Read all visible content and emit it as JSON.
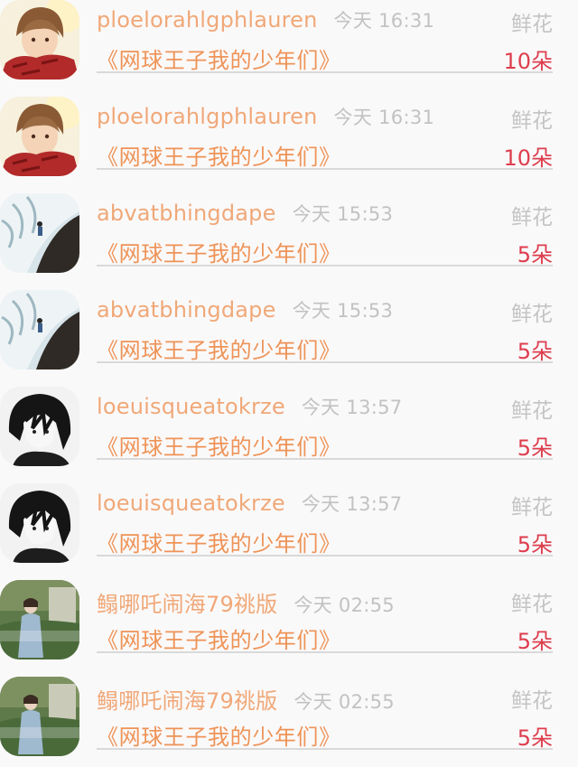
{
  "records": [
    {
      "avatar_icon": "boy-red-scarf-avatar",
      "username": "ploelorahlgphlauren",
      "time": "今天 16:31",
      "gift": "鲜花",
      "title": "《网球王子我的少年们》",
      "count": "10朵"
    },
    {
      "avatar_icon": "boy-red-scarf-avatar",
      "username": "ploelorahlgphlauren",
      "time": "今天 16:31",
      "gift": "鲜花",
      "title": "《网球王子我的少年们》",
      "count": "10朵"
    },
    {
      "avatar_icon": "seaside-figure-avatar",
      "username": "abvatbhingdape",
      "time": "今天 15:53",
      "gift": "鲜花",
      "title": "《网球王子我的少年们》",
      "count": "5朵"
    },
    {
      "avatar_icon": "seaside-figure-avatar",
      "username": "abvatbhingdape",
      "time": "今天 15:53",
      "gift": "鲜花",
      "title": "《网球王子我的少年们》",
      "count": "5朵"
    },
    {
      "avatar_icon": "monochrome-anime-avatar",
      "username": "loeuisqueatokrze",
      "time": "今天 13:57",
      "gift": "鲜花",
      "title": "《网球王子我的少年们》",
      "count": "5朵"
    },
    {
      "avatar_icon": "monochrome-anime-avatar",
      "username": "loeuisqueatokrze",
      "time": "今天 13:57",
      "gift": "鲜花",
      "title": "《网球王子我的少年们》",
      "count": "5朵"
    },
    {
      "avatar_icon": "garden-girl-avatar",
      "username": "鳎哪吒闹海79祧版",
      "time": "今天 02:55",
      "gift": "鲜花",
      "title": "《网球王子我的少年们》",
      "count": "5朵"
    },
    {
      "avatar_icon": "garden-girl-avatar",
      "username": "鳎哪吒闹海79祧版",
      "time": "今天 02:55",
      "gift": "鲜花",
      "title": "《网球王子我的少年们》",
      "count": "5朵"
    }
  ]
}
